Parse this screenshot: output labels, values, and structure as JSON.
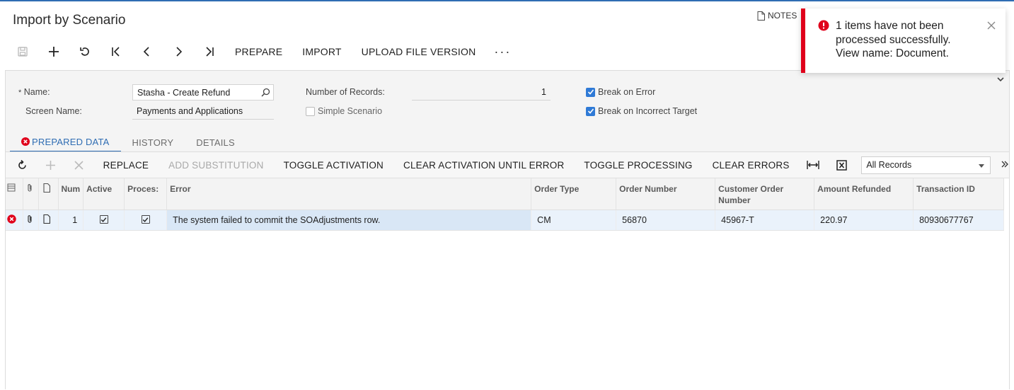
{
  "page": {
    "title": "Import by Scenario",
    "notes_label": "NOTES"
  },
  "toolbar": {
    "prepare": "PREPARE",
    "import": "IMPORT",
    "upload": "UPLOAD FILE VERSION",
    "more": "···"
  },
  "form": {
    "name_label": "Name:",
    "name_required_mark": "*",
    "name_value": "Stasha - Create Refund",
    "screen_label": "Screen Name:",
    "screen_value": "Payments and Applications",
    "records_label": "Number of Records:",
    "records_value": "1",
    "simple_scenario": "Simple Scenario",
    "break_on_error": "Break on Error",
    "break_on_target": "Break on Incorrect Target"
  },
  "tabs": [
    {
      "label": "PREPARED DATA"
    },
    {
      "label": "HISTORY"
    },
    {
      "label": "DETAILS"
    }
  ],
  "grid_toolbar": {
    "replace": "REPLACE",
    "add_substitution": "ADD SUBSTITUTION",
    "toggle_activation": "TOGGLE ACTIVATION",
    "clear_activation": "CLEAR ACTIVATION UNTIL ERROR",
    "toggle_processing": "TOGGLE PROCESSING",
    "clear_errors": "CLEAR ERRORS",
    "filter_value": "All Records"
  },
  "columns": {
    "num": "Num",
    "active": "Active",
    "processed": "Proces:",
    "error": "Error",
    "order_type": "Order Type",
    "order_number": "Order Number",
    "customer_order": "Customer Order Number",
    "amount_refunded": "Amount Refunded",
    "transaction_id": "Transaction ID"
  },
  "rows": [
    {
      "num": "1",
      "error": "The system failed to commit the SOAdjustments row.",
      "order_type": "CM",
      "order_number": "56870",
      "customer_order": "45967-T",
      "amount_refunded": "220.97",
      "transaction_id": "80930677767"
    }
  ],
  "toast": {
    "line1": "1 items have not been",
    "line2": "processed successfully.",
    "line3": "View name: Document."
  },
  "colors": {
    "accent": "#2f6db3",
    "error": "#e0001b",
    "checkbox": "#2f7ad6"
  }
}
